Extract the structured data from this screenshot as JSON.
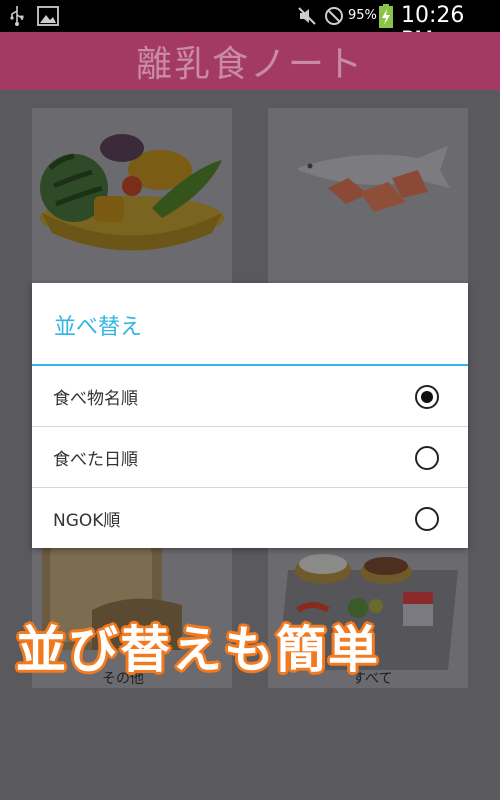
{
  "status_bar": {
    "battery_percent": "95%",
    "time": "10:26 PM",
    "icons": [
      "usb-icon",
      "image-icon",
      "mute-icon",
      "do-not-disturb-icon",
      "battery-charging-icon"
    ]
  },
  "app": {
    "title": "離乳食ノート",
    "header_color": "#a33a66"
  },
  "categories": [
    {
      "name": "vegetables",
      "label": ""
    },
    {
      "name": "fish",
      "label": ""
    },
    {
      "name": "other",
      "label": "その他"
    },
    {
      "name": "all",
      "label": "すべて"
    }
  ],
  "dialog": {
    "title": "並べ替え",
    "accent_color": "#33b5e5",
    "options": [
      {
        "label": "食べ物名順",
        "checked": true
      },
      {
        "label": "食べた日順",
        "checked": false
      },
      {
        "label": "NGOK順",
        "checked": false
      }
    ]
  },
  "banner": {
    "text": "並び替えも簡単",
    "outline_color": "#f37a1f"
  }
}
